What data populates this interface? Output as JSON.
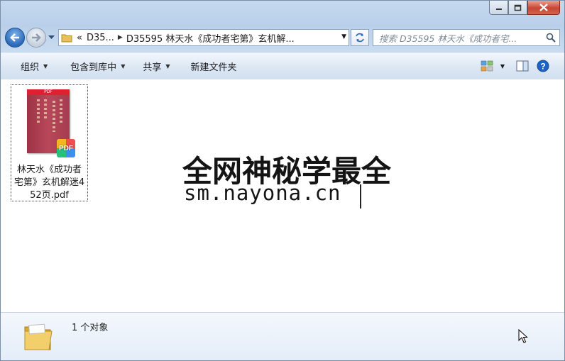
{
  "window": {
    "controls": [
      "minimize",
      "maximize",
      "close"
    ]
  },
  "nav": {
    "back_icon": "back-arrow-icon",
    "forward_icon": "forward-arrow-icon"
  },
  "address": {
    "overflow": "«",
    "crumbs": [
      "D35...",
      "D35595 林天水《成功者宅第》玄机解..."
    ]
  },
  "search": {
    "placeholder": "搜索 D35595 林天水《成功者宅..."
  },
  "toolbar": {
    "organize": "组织",
    "include_library": "包含到库中",
    "share": "共享",
    "new_folder": "新建文件夹"
  },
  "files": [
    {
      "name": "林天水《成功者宅第》玄机解迷452页.pdf",
      "badge": "PDF",
      "thumb_header": "PDF"
    }
  ],
  "watermark": {
    "line1": "全网神秘学最全",
    "line2": "sm.nayona.cn"
  },
  "details": {
    "count_text": "1 个对象"
  },
  "colors": {
    "accent": "#2a69b8",
    "close": "#c74634",
    "cover": "#a53c4f"
  }
}
